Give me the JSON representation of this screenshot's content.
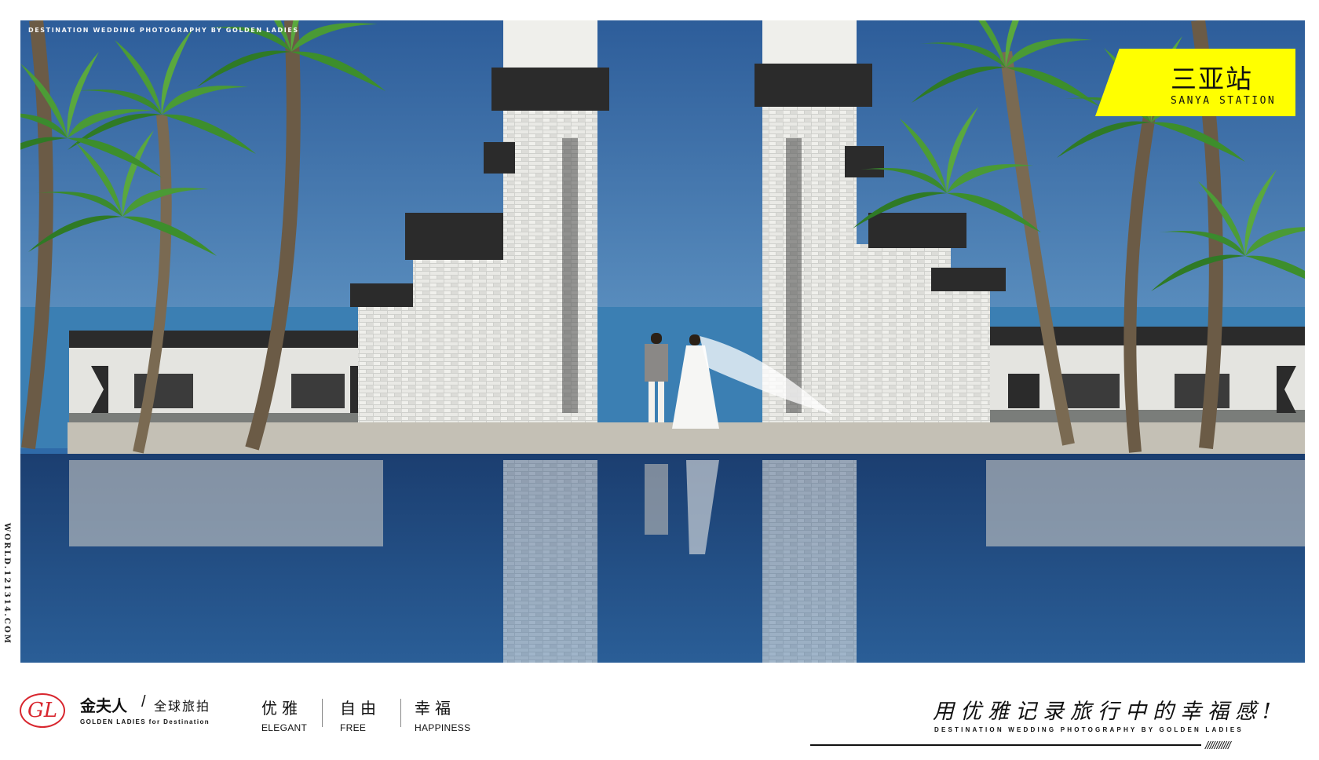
{
  "photo": {
    "top_caption": "DESTINATION WEDDING PHOTOGRAPHY BY GOLDEN LADIES",
    "station_title": "三亚站",
    "station_subtitle": "SANYA STATION"
  },
  "side_url": "WORLD.121314.COM",
  "brand": {
    "logo_letter": "GL",
    "name_cn": "金夫人",
    "slash": "/",
    "tagline_cn": "全球旅拍",
    "name_en": "GOLDEN LADIES  for  Destination"
  },
  "values": [
    {
      "cn": "优雅",
      "en": "ELEGANT"
    },
    {
      "cn": "自由",
      "en": "FREE"
    },
    {
      "cn": "幸福",
      "en": "HAPPINESS"
    }
  ],
  "slogan": {
    "cn": "用优雅记录旅行中的幸福感!",
    "en": "DESTINATION WEDDING PHOTOGRAPHY BY GOLDEN LADIES",
    "hatch": "///////////"
  },
  "colors": {
    "badge": "#ffff00",
    "logo_red": "#d8262e",
    "sky": "#2f6aa8",
    "sea": "#3b7fb3",
    "wall": "#d9d9d4",
    "roof": "#2b2b2b"
  }
}
